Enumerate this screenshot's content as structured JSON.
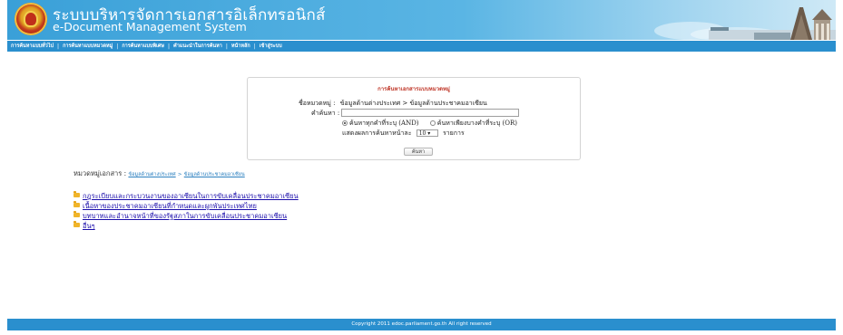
{
  "header": {
    "title_th": "ระบบบริหารจัดการเอกสารอิเล็กทรอนิกส์",
    "title_en": "e-Document Management System"
  },
  "nav": {
    "items": [
      "การค้นหาแบบทั่วไป",
      "การค้นหาแบบหมวดหมู่",
      "การค้นหาแบบพิเศษ",
      "คำแนะนำในการค้นหา",
      "หน้าหลัก",
      "เข้าสู่ระบบ"
    ],
    "separator": "|"
  },
  "search": {
    "title": "การค้นหาเอกสารแบบหมวดหมู่",
    "category_label": "ชื่อหมวดหมู่ :",
    "category_value": "ข้อมูลด้านต่างประเทศ > ข้อมูลด้านประชาคมอาเซียน",
    "keyword_label": "คำค้นหา :",
    "keyword_value": "",
    "radio_and": "ค้นหาทุกคำที่ระบุ (AND)",
    "radio_or": "ค้นหาเพียงบางคำที่ระบุ (OR)",
    "per_page_label": "แสดงผลการค้นหาหน้าละ",
    "per_page_value": "10 ▾",
    "per_page_suffix": "รายการ",
    "submit_label": "ค้นหา"
  },
  "category": {
    "label": "หมวดหมู่เอกสาร :",
    "crumb1": "ข้อมูลด้านต่างประเทศ",
    "crumb_sep": ">",
    "crumb2": "ข้อมูลด้านประชาคมอาเซียน"
  },
  "documents": [
    "กฎระเบียบและกระบวนงานของอาเซียนในการขับเคลื่อนประชาคมอาเซียน",
    "เนื้อหาของประชาคมอาเซียนที่กำหนดและผูกพันประเทศไทย",
    "บทบาทและอำนาจหน้าที่ของรัฐสภาในการขับเคลื่อนประชาคมอาเซียน",
    "อื่นๆ"
  ],
  "footer": {
    "copyright": "Copyright 2011 edoc.parliament.go.th All right reserved"
  }
}
